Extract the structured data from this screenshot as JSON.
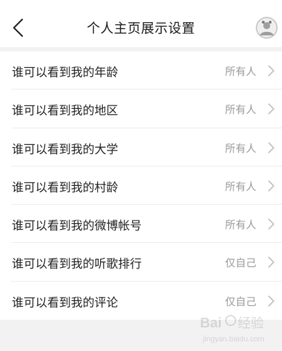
{
  "header": {
    "title": "个人主页展示设置",
    "back_icon": "chevron-left-icon",
    "avatar_icon": "user-avatar"
  },
  "settings": [
    {
      "label": "谁可以看到我的年龄",
      "value": "所有人"
    },
    {
      "label": "谁可以看到我的地区",
      "value": "所有人"
    },
    {
      "label": "谁可以看到我的大学",
      "value": "所有人"
    },
    {
      "label": "谁可以看到我的村龄",
      "value": "所有人"
    },
    {
      "label": "谁可以看到我的微博帐号",
      "value": "所有人"
    },
    {
      "label": "谁可以看到我的听歌排行",
      "value": "仅自己"
    },
    {
      "label": "谁可以看到我的评论",
      "value": "仅自己"
    }
  ],
  "colors": {
    "background": "#f2f2f2",
    "text_primary": "#222222",
    "text_secondary": "#9a9a9a",
    "divider": "#ececec"
  },
  "watermark": {
    "text": "Bai 经验",
    "subtext": "jingyan.baidu.com"
  }
}
